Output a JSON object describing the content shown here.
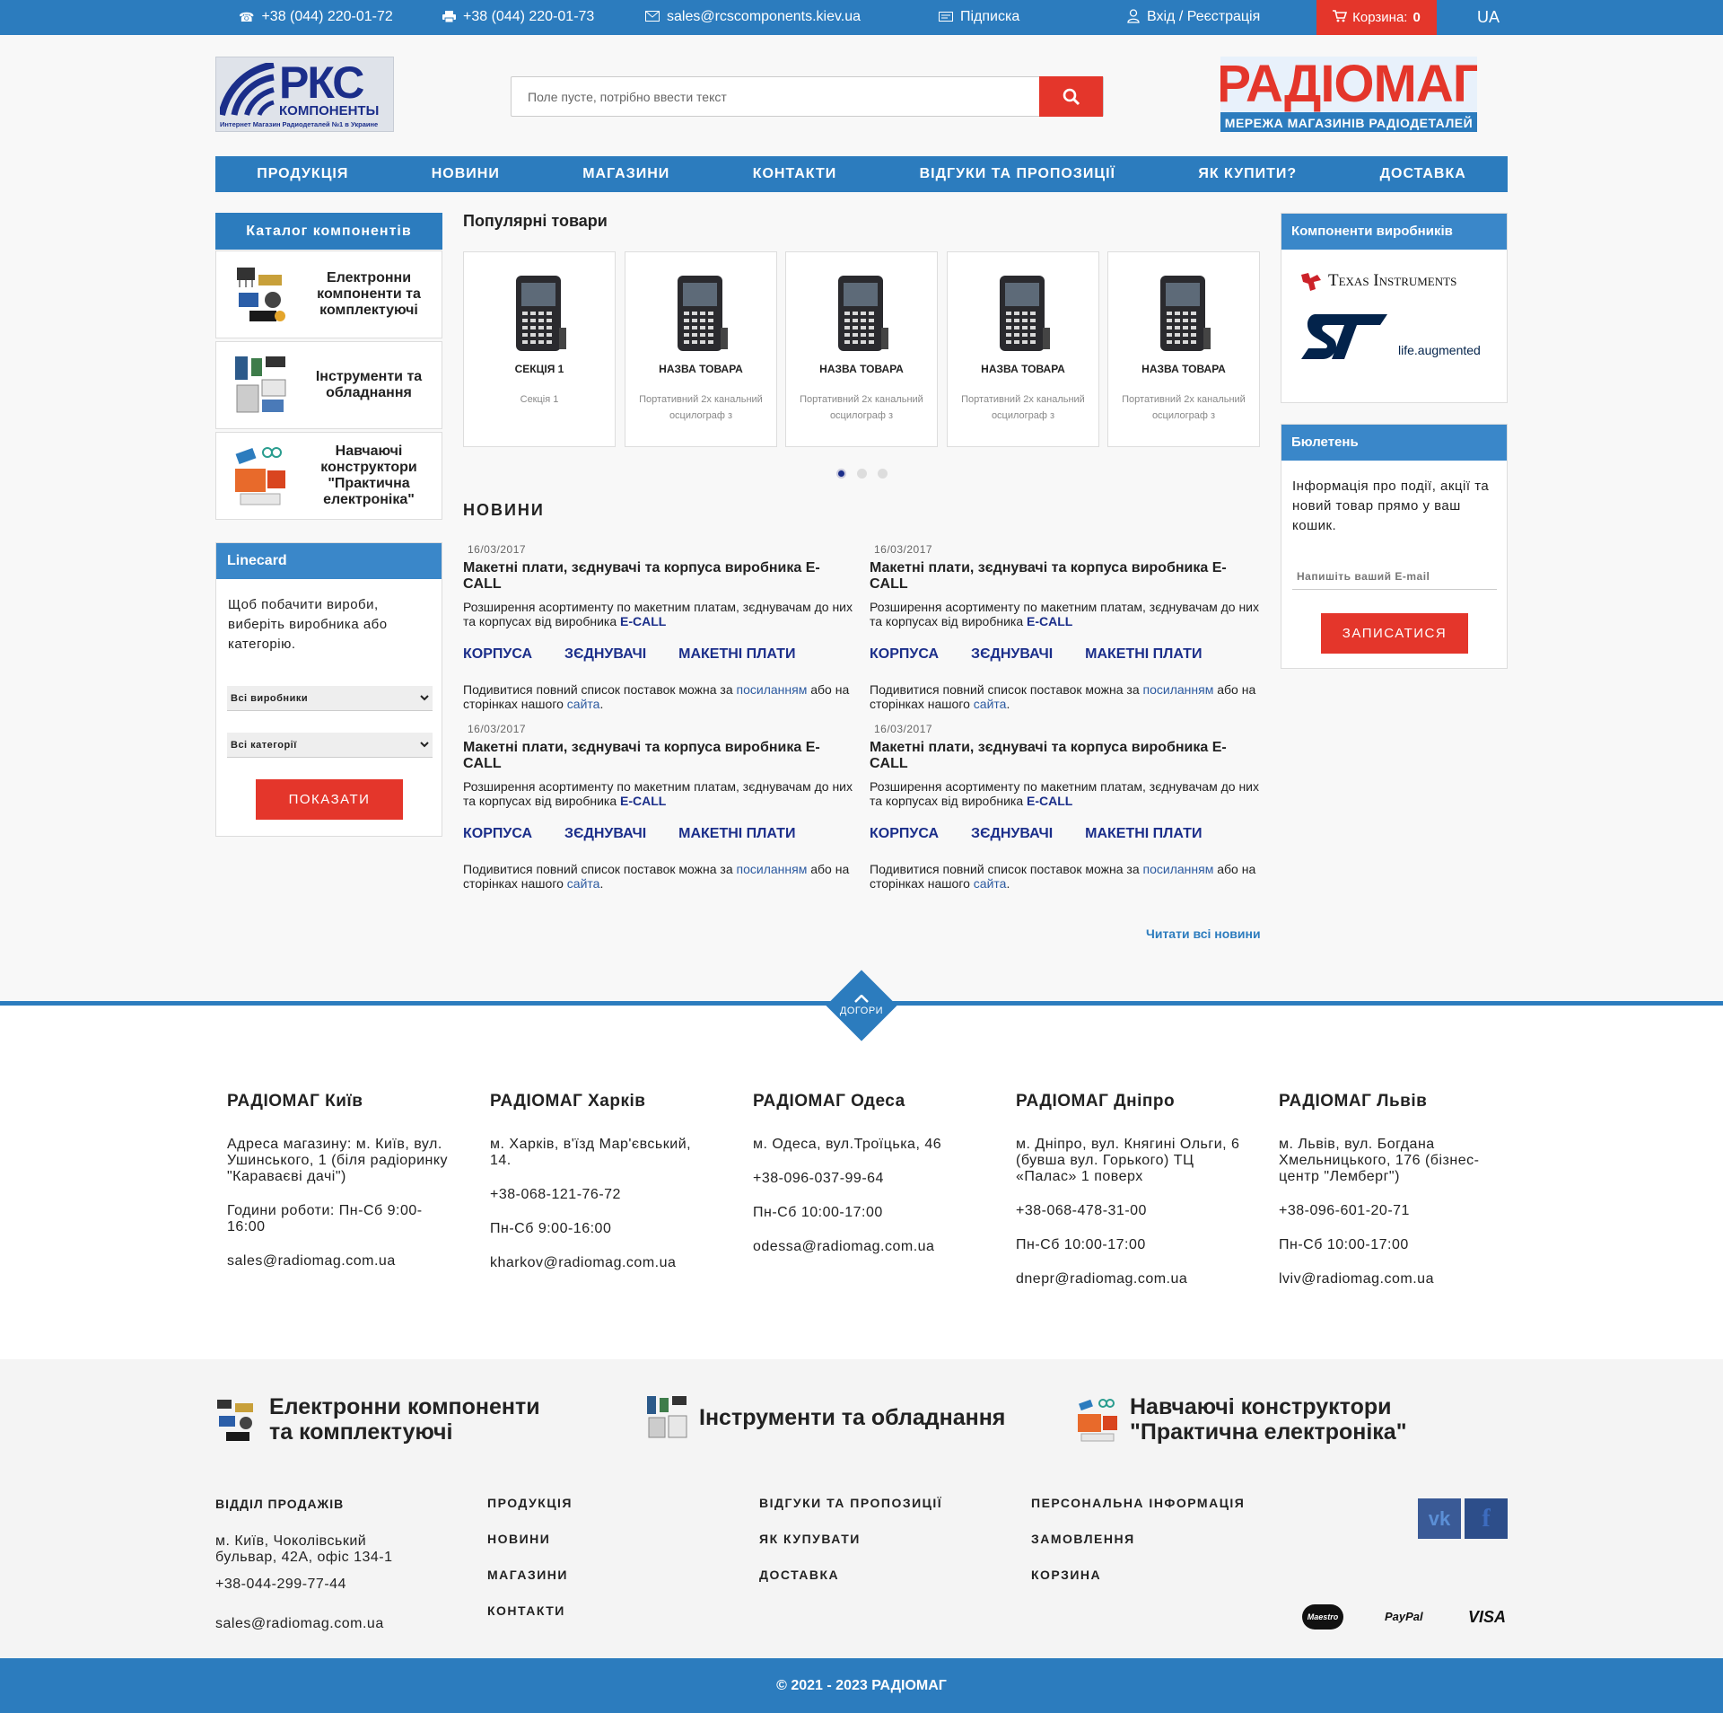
{
  "topbar": {
    "phone1": "+38 (044) 220-01-72",
    "phone2": "+38 (044) 220-01-73",
    "email": "sales@rcscomponents.kiev.ua",
    "subscribe": "Підписка",
    "login": "Вхід / Реєстрація",
    "cart_label": "Корзина:",
    "cart_count": "0",
    "lang": "UA"
  },
  "header": {
    "logo_left_big": "РКС",
    "logo_left_sub": "КОМПОНЕНТЫ",
    "logo_left_tag": "Интернет Магазин Радиодеталей №1 в Украине",
    "search_placeholder": "Поле пусте, потрібно ввести текст",
    "logo_right_top": "РАДІОМАГ",
    "logo_right_bottom": "МЕРЕЖА МАГАЗИНІВ РАДІОДЕТАЛЕЙ"
  },
  "nav": [
    "ПРОДУКЦІЯ",
    "НОВИНИ",
    "МАГАЗИНИ",
    "КОНТАКТИ",
    "ВІДГУКИ ТА ПРОПОЗИЦІЇ",
    "ЯК КУПИТИ?",
    "ДОСТАВКА"
  ],
  "catalog": {
    "title": "Каталог компонентів",
    "items": [
      "Електронни компоненти та комплектуючі",
      "Інструменти та обладнання",
      "Навчаючі конструктори \"Практична електроніка\""
    ]
  },
  "linecard": {
    "title": "Linecard",
    "text": "Щоб побачити вироби, виберіть виробника або категорію.",
    "select_mfr": "Всі виробники",
    "select_cat": "Всі категорії",
    "button": "ПОКАЗАТИ"
  },
  "popular": {
    "title": "Популярні товари",
    "products": [
      {
        "name": "СЕКЦІЯ 1",
        "desc": "Секція 1"
      },
      {
        "name": "НАЗВА ТОВАРА",
        "desc": "Портативний 2х канальний осцилограф з"
      },
      {
        "name": "НАЗВА ТОВАРА",
        "desc": "Портативний 2х канальний осцилограф з"
      },
      {
        "name": "НАЗВА ТОВАРА",
        "desc": "Портативний 2х канальний осцилограф з"
      },
      {
        "name": "НАЗВА ТОВАРА",
        "desc": "Портативний 2х канальний осцилограф з"
      }
    ]
  },
  "news": {
    "title": "НОВИНИ",
    "items": [
      {
        "date": "16/03/2017",
        "heading": "Макетні плати, зєднувачі та корпуса виробника E-CALL",
        "text": "Розширення асортименту по макетним платам, зєднувачам до них та корпусах від виробника ",
        "brand": "E-CALL",
        "tags": [
          "КОРПУСА",
          "ЗЄДНУВАЧІ",
          "МАКЕТНІ ПЛАТИ"
        ],
        "foot1": "Подивитися повний список поставок можна за ",
        "foot_link1": "посиланням",
        "foot2": " або на сторінках нашого ",
        "foot_link2": "сайта",
        "foot3": "."
      },
      {
        "date": "16/03/2017",
        "heading": "Макетні плати, зєднувачі та корпуса виробника E-CALL",
        "text": "Розширення асортименту по макетним платам, зєднувачам до них та корпусах від виробника ",
        "brand": "E-CALL",
        "tags": [
          "КОРПУСА",
          "ЗЄДНУВАЧІ",
          "МАКЕТНІ ПЛАТИ"
        ],
        "foot1": "Подивитися повний список поставок можна за ",
        "foot_link1": "посиланням",
        "foot2": " або на сторінках нашого ",
        "foot_link2": "сайта",
        "foot3": "."
      },
      {
        "date": "16/03/2017",
        "heading": "Макетні плати, зєднувачі та корпуса виробника E-CALL",
        "text": "Розширення асортименту по макетним платам, зєднувачам до них та корпусах від виробника ",
        "brand": "E-CALL",
        "tags": [
          "КОРПУСА",
          "ЗЄДНУВАЧІ",
          "МАКЕТНІ ПЛАТИ"
        ],
        "foot1": "Подивитися повний список поставок можна за ",
        "foot_link1": "посиланням",
        "foot2": " або на сторінках нашого ",
        "foot_link2": "сайта",
        "foot3": "."
      },
      {
        "date": "16/03/2017",
        "heading": "Макетні плати, зєднувачі та корпуса виробника E-CALL",
        "text": "Розширення асортименту по макетним платам, зєднувачам до них та корпусах від виробника ",
        "brand": "E-CALL",
        "tags": [
          "КОРПУСА",
          "ЗЄДНУВАЧІ",
          "МАКЕТНІ ПЛАТИ"
        ],
        "foot1": "Подивитися повний список поставок можна за ",
        "foot_link1": "посиланням",
        "foot2": " або на сторінках нашого ",
        "foot_link2": "сайта",
        "foot3": "."
      }
    ],
    "read_all": "Читати всі новини"
  },
  "manufacturers": {
    "title": "Компоненти виробників",
    "ti": "Texas Instruments",
    "st_tag": "life.augmented"
  },
  "bulletin": {
    "title": "Бюлетень",
    "text": "Інформація про події, акції та новий товар прямо у ваш кошик.",
    "email_placeholder": "Напишіть ваший E-mail",
    "button": "ЗАПИСАТИСЯ"
  },
  "gotop": "ДОГОРИ",
  "stores": [
    {
      "title": "РАДІОМАГ Київ",
      "lines": [
        "Адреса магазину: м. Київ, вул. Ушинського, 1 (біля радіоринку \"Караваєві дачі\")",
        "",
        "Години роботи: Пн-Сб 9:00-16:00",
        "sales@radiomag.com.ua"
      ]
    },
    {
      "title": "РАДІОМАГ Харків",
      "lines": [
        "м. Харків, в'їзд Мар'євський, 14.",
        "+38-068-121-76-72",
        "Пн-Сб 9:00-16:00",
        "kharkov@radiomag.com.ua"
      ]
    },
    {
      "title": "РАДІОМАГ Одеса",
      "lines": [
        "м. Одеса, вул.Троїцька, 46",
        "+38-096-037-99-64",
        "Пн-Сб 10:00-17:00",
        "odessa@radiomag.com.ua"
      ]
    },
    {
      "title": "РАДІОМАГ Дніпро",
      "lines": [
        "м. Дніпро, вул. Княгині Ольги, 6 (бувша вул. Горького) ТЦ «Палас» 1 поверх",
        "+38-068-478-31-00",
        "Пн-Сб 10:00-17:00",
        "dnepr@radiomag.com.ua"
      ]
    },
    {
      "title": "РАДІОМАГ Львів",
      "lines": [
        "м. Львів, вул. Богдана Хмельницького, 176 (бізнес-центр \"Лемберг\")",
        "+38-096-601-20-71",
        "Пн-Сб 10:00-17:00",
        "lviv@radiomag.com.ua"
      ]
    }
  ],
  "footer_cats": [
    "Електронни компоненти та комплектуючі",
    "Інструменти та обладнання",
    "Навчаючі конструктори \"Практична електроніка\""
  ],
  "sales": {
    "title": "ВІДДІЛ ПРОДАЖІВ",
    "address": "м. Київ, Чоколівський бульвар, 42А, офіс 134-1",
    "phone": "+38-044-299-77-44",
    "email": "sales@radiomag.com.ua"
  },
  "footer_links": [
    [
      "ПРОДУКЦІЯ",
      "НОВИНИ",
      "МАГАЗИНИ",
      "КОНТАКТИ"
    ],
    [
      "ВІДГУКИ ТА ПРОПОЗИЦІЇ",
      "ЯК КУПУВАТИ",
      "ДОСТАВКА"
    ],
    [
      "ПЕРСОНАЛЬНА ІНФОРМАЦІЯ",
      "ЗАМОВЛЕННЯ",
      "КОРЗИНА"
    ]
  ],
  "social": {
    "vk": "vk",
    "fb": "f"
  },
  "payments": [
    "Maestro",
    "PayPal",
    "VISA"
  ],
  "copyright": "© 2021 - 2023 РАДІОМАГ",
  "colors": {
    "primary": "#2c7cbe",
    "accent": "#e4362b",
    "dark_link": "#1b2e8a"
  }
}
